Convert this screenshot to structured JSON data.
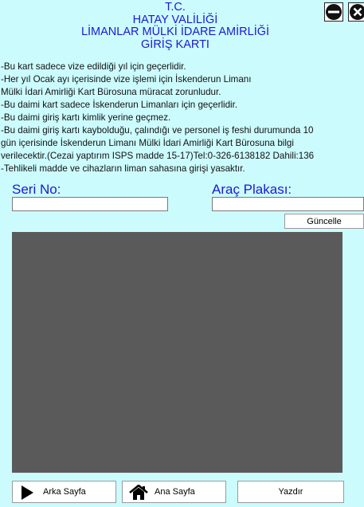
{
  "header": {
    "lines": [
      "T.C.",
      "HATAY VALİLİĞİ",
      "LİMANLAR MÜLKİ İDARE AMİRLİĞİ",
      "GİRİŞ KARTI"
    ]
  },
  "notes": [
    "-Bu kart sadece vize edildiği yıl için geçerlidir.",
    "-Her yıl Ocak ayı içerisinde vize işlemi için İskenderun Limanı",
    "Mülki İdari Amirliği Kart Bürosuna müracat zorunludur.",
    "-Bu daimi kart sadece İskenderun Limanları için geçerlidir.",
    "-Bu daimi giriş kartı kimlik yerine geçmez.",
    "-Bu daimi giriş kartı kaybolduğu, çalındığı ve personel iş feshi durumunda 10",
    "gün içerisinde İskenderun Limanı Mülki İdari Amirliği Kart Bürosuna bilgi",
    "verilecektir.(Cezai yaptırım ISPS madde 15-17)Tel:0-326-6138182 Dahili:136",
    "-Tehlikeli madde ve cihazların liman sahasına girişi yasaktır."
  ],
  "form": {
    "seri_label": "Seri No:",
    "seri_value": "",
    "plaka_label": "Araç Plakası:",
    "plaka_value": "",
    "update_button": "Güncelle"
  },
  "bottom": {
    "back_label": "Arka Sayfa",
    "home_label": "Ana Sayfa",
    "print_label": "Yazdır"
  },
  "icons": {
    "minimize": "minimize-icon",
    "close": "close-icon",
    "back": "play-icon",
    "home": "home-icon"
  },
  "colors": {
    "background": "#ccfbfd",
    "accent": "#1a1ad6",
    "panel": "#5a5a5a"
  }
}
